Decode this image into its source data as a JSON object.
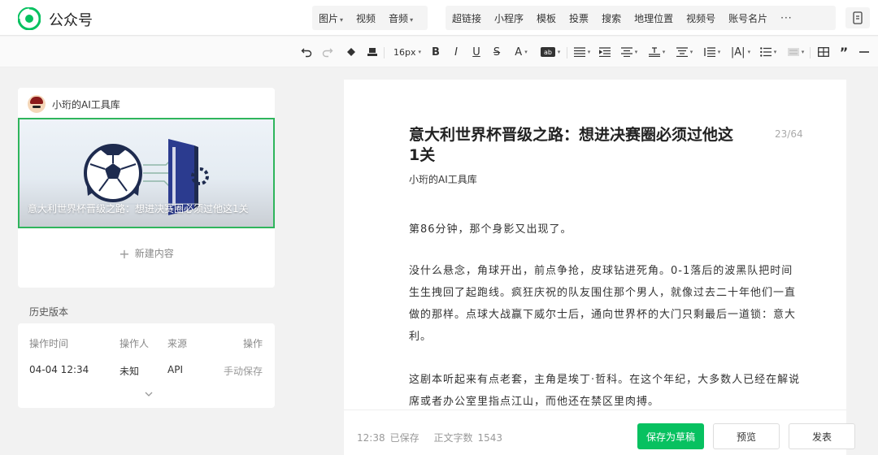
{
  "app": {
    "brand": "公众号",
    "brand_color": "#07c160"
  },
  "insert_menu": {
    "group1": [
      {
        "label": "图片",
        "caret": "▾"
      },
      {
        "label": "视频"
      },
      {
        "label": "音频",
        "caret": "▾"
      }
    ],
    "group2": [
      {
        "label": "超链接"
      },
      {
        "label": "小程序"
      },
      {
        "label": "模板"
      },
      {
        "label": "投票"
      },
      {
        "label": "搜索"
      },
      {
        "label": "地理位置"
      },
      {
        "label": "视频号"
      },
      {
        "label": "账号名片"
      },
      {
        "label": "···"
      }
    ]
  },
  "format_toolbar": {
    "font_size": "16px",
    "icons": [
      "undo-icon",
      "redo-icon",
      "format-brush-icon",
      "clear-format-icon",
      "bold-icon",
      "italic-icon",
      "underline-icon",
      "strikethrough-icon",
      "font-color-icon",
      "background-color-icon",
      "align-left-icon",
      "align-center-icon",
      "indent-icon",
      "letter-spacing-icon",
      "line-height-icon",
      "paragraph-spacing-icon",
      "text-direction-icon",
      "list-icon",
      "block-style-icon",
      "table-icon",
      "quote-icon",
      "divider-icon"
    ]
  },
  "left_panel": {
    "account_name": "小珩的AI工具库",
    "cover_title": "意大利世界杯晋级之路：想进决赛圈必须过他这1关",
    "new_content_label": "新建内容",
    "history": {
      "title": "历史版本",
      "headers": [
        "操作时间",
        "操作人",
        "来源",
        "操作"
      ],
      "rows": [
        {
          "time": "04-04 12:34",
          "operator": "未知",
          "source": "API",
          "action": "手动保存"
        }
      ]
    }
  },
  "editor": {
    "title": "意大利世界杯晋级之路：想进决赛圈必须过他这1关",
    "title_counter": "23/64",
    "author": "小珩的AI工具库",
    "paragraphs": [
      "第86分钟，那个身影又出现了。",
      "没什么悬念，角球开出，前点争抢，皮球钻进死角。0-1落后的波黑队把时间生生拽回了起跑线。疯狂庆祝的队友围住那个男人，就像过去二十年他们一直做的那样。点球大战赢下威尔士后，通向世界杯的大门只剩最后一道锁：意大利。",
      "这剧本听起来有点老套，主角是埃丁·哲科。在这个年纪，大多数人已经在解说席或者办公室里指点江山，而他还在禁区里肉搏。"
    ]
  },
  "bottom_bar": {
    "time": "12:38",
    "saved": "已保存",
    "word_count_label": "正文字数",
    "word_count": "1543",
    "save_draft": "保存为草稿",
    "preview": "预览",
    "publish": "发表"
  }
}
